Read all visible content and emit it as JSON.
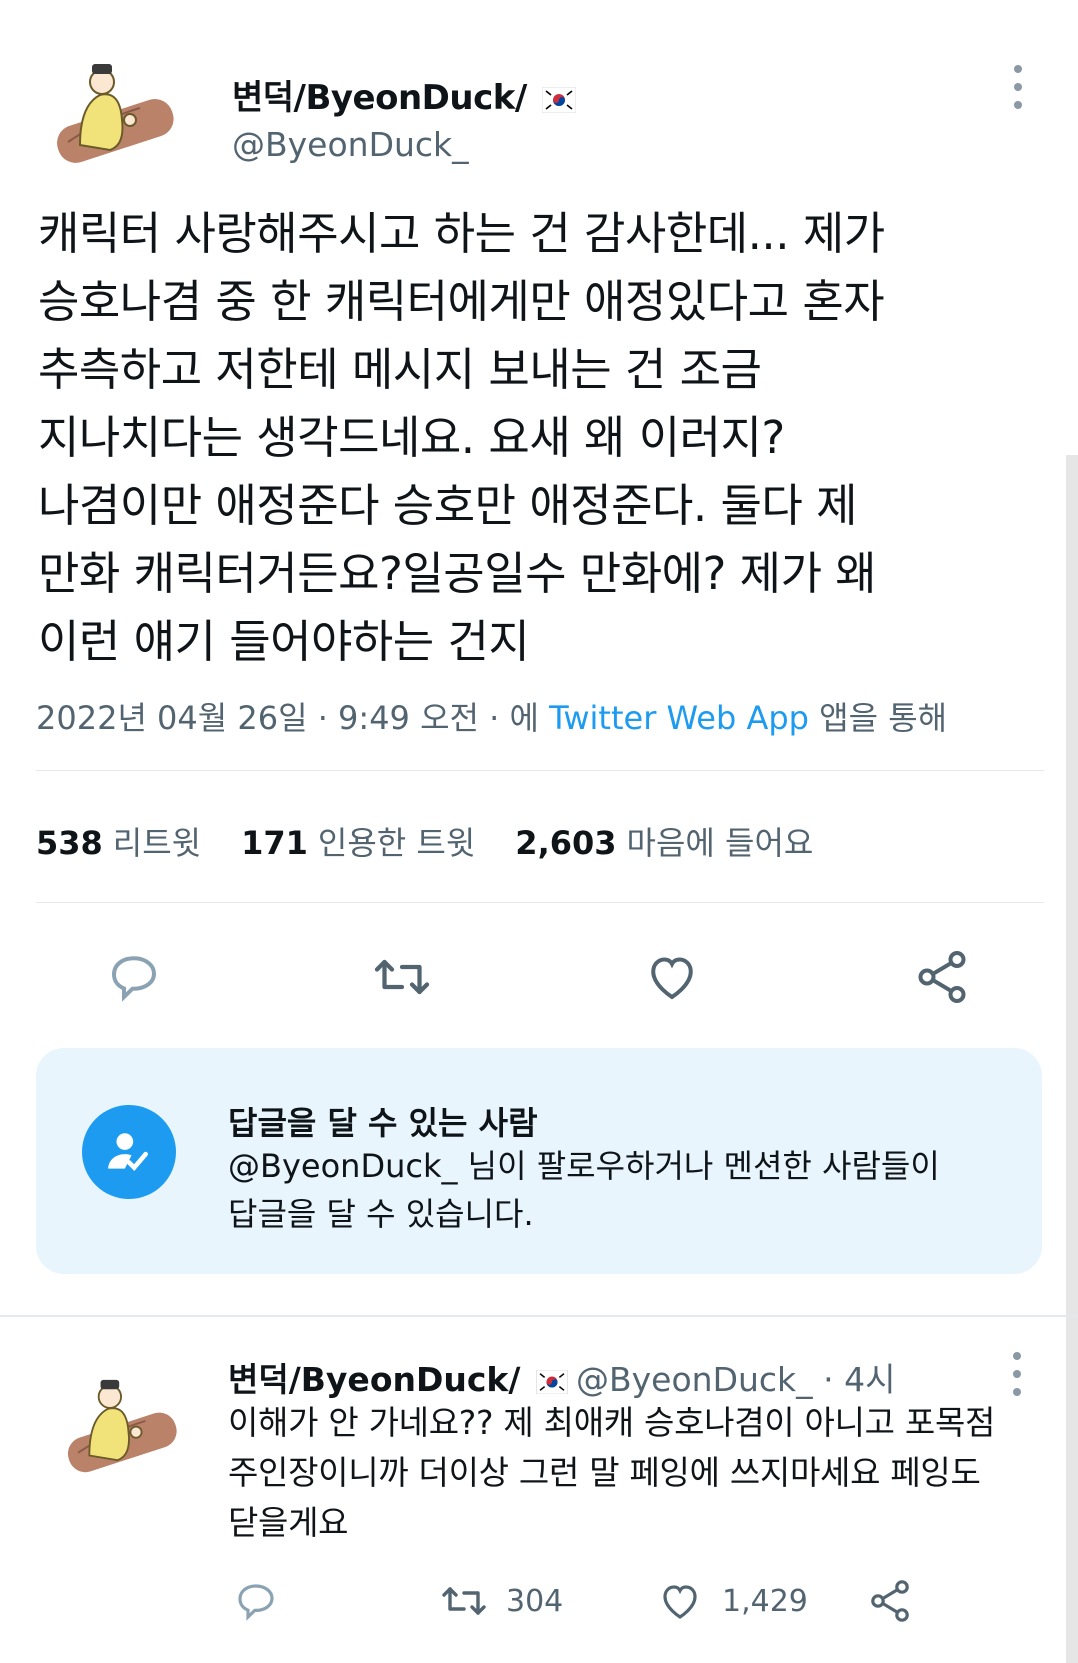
{
  "main_tweet": {
    "author_name": "변덕/ByeonDuck/",
    "author_handle": "@ByeonDuck_",
    "text": "캐릭터 사랑해주시고 하는 건 감사한데... 제가\n승호나겸 중 한 캐릭터에게만 애정있다고 혼자\n추측하고 저한테 메시지 보내는 건 조금\n지나치다는 생각드네요. 요새 왜 이러지?\n나겸이만 애정준다 승호만 애정준다. 둘다 제\n만화 캐릭터거든요?일공일수 만화에? 제가 왜\n이런 얘기 들어야하는 건지",
    "date": "2022년 04월 26일 · 9:49 오전 · 에 ",
    "source": "Twitter Web App",
    "source_suffix": " 앱을 통해",
    "stats": {
      "retweets_count": "538",
      "retweets_label": "리트윗",
      "quotes_count": "171",
      "quotes_label": "인용한 트윗",
      "likes_count": "2,603",
      "likes_label": "마음에 들어요"
    }
  },
  "reply_restriction": {
    "title": "답글을 달 수 있는 사람",
    "description": "@ByeonDuck_ 님이 팔로우하거나 멘션한 사람들이\n답글을 달 수 있습니다."
  },
  "reply_tweet": {
    "author_name": "변덕/ByeonDuck/",
    "author_handle": "@ByeonDuck_ · 4시",
    "text": "이해가 안 가네요?? 제 최애캐 승호나겸이 아니고 포목점\n주인장이니까 더이상 그런 말 페잉에 쓰지마세요 페잉도\n닫을게요",
    "retweets": "304",
    "likes": "1,429"
  },
  "colors": {
    "accent": "#1d9bf0",
    "secondary_text": "#536471",
    "reply_box_bg": "#e8f5fd"
  }
}
